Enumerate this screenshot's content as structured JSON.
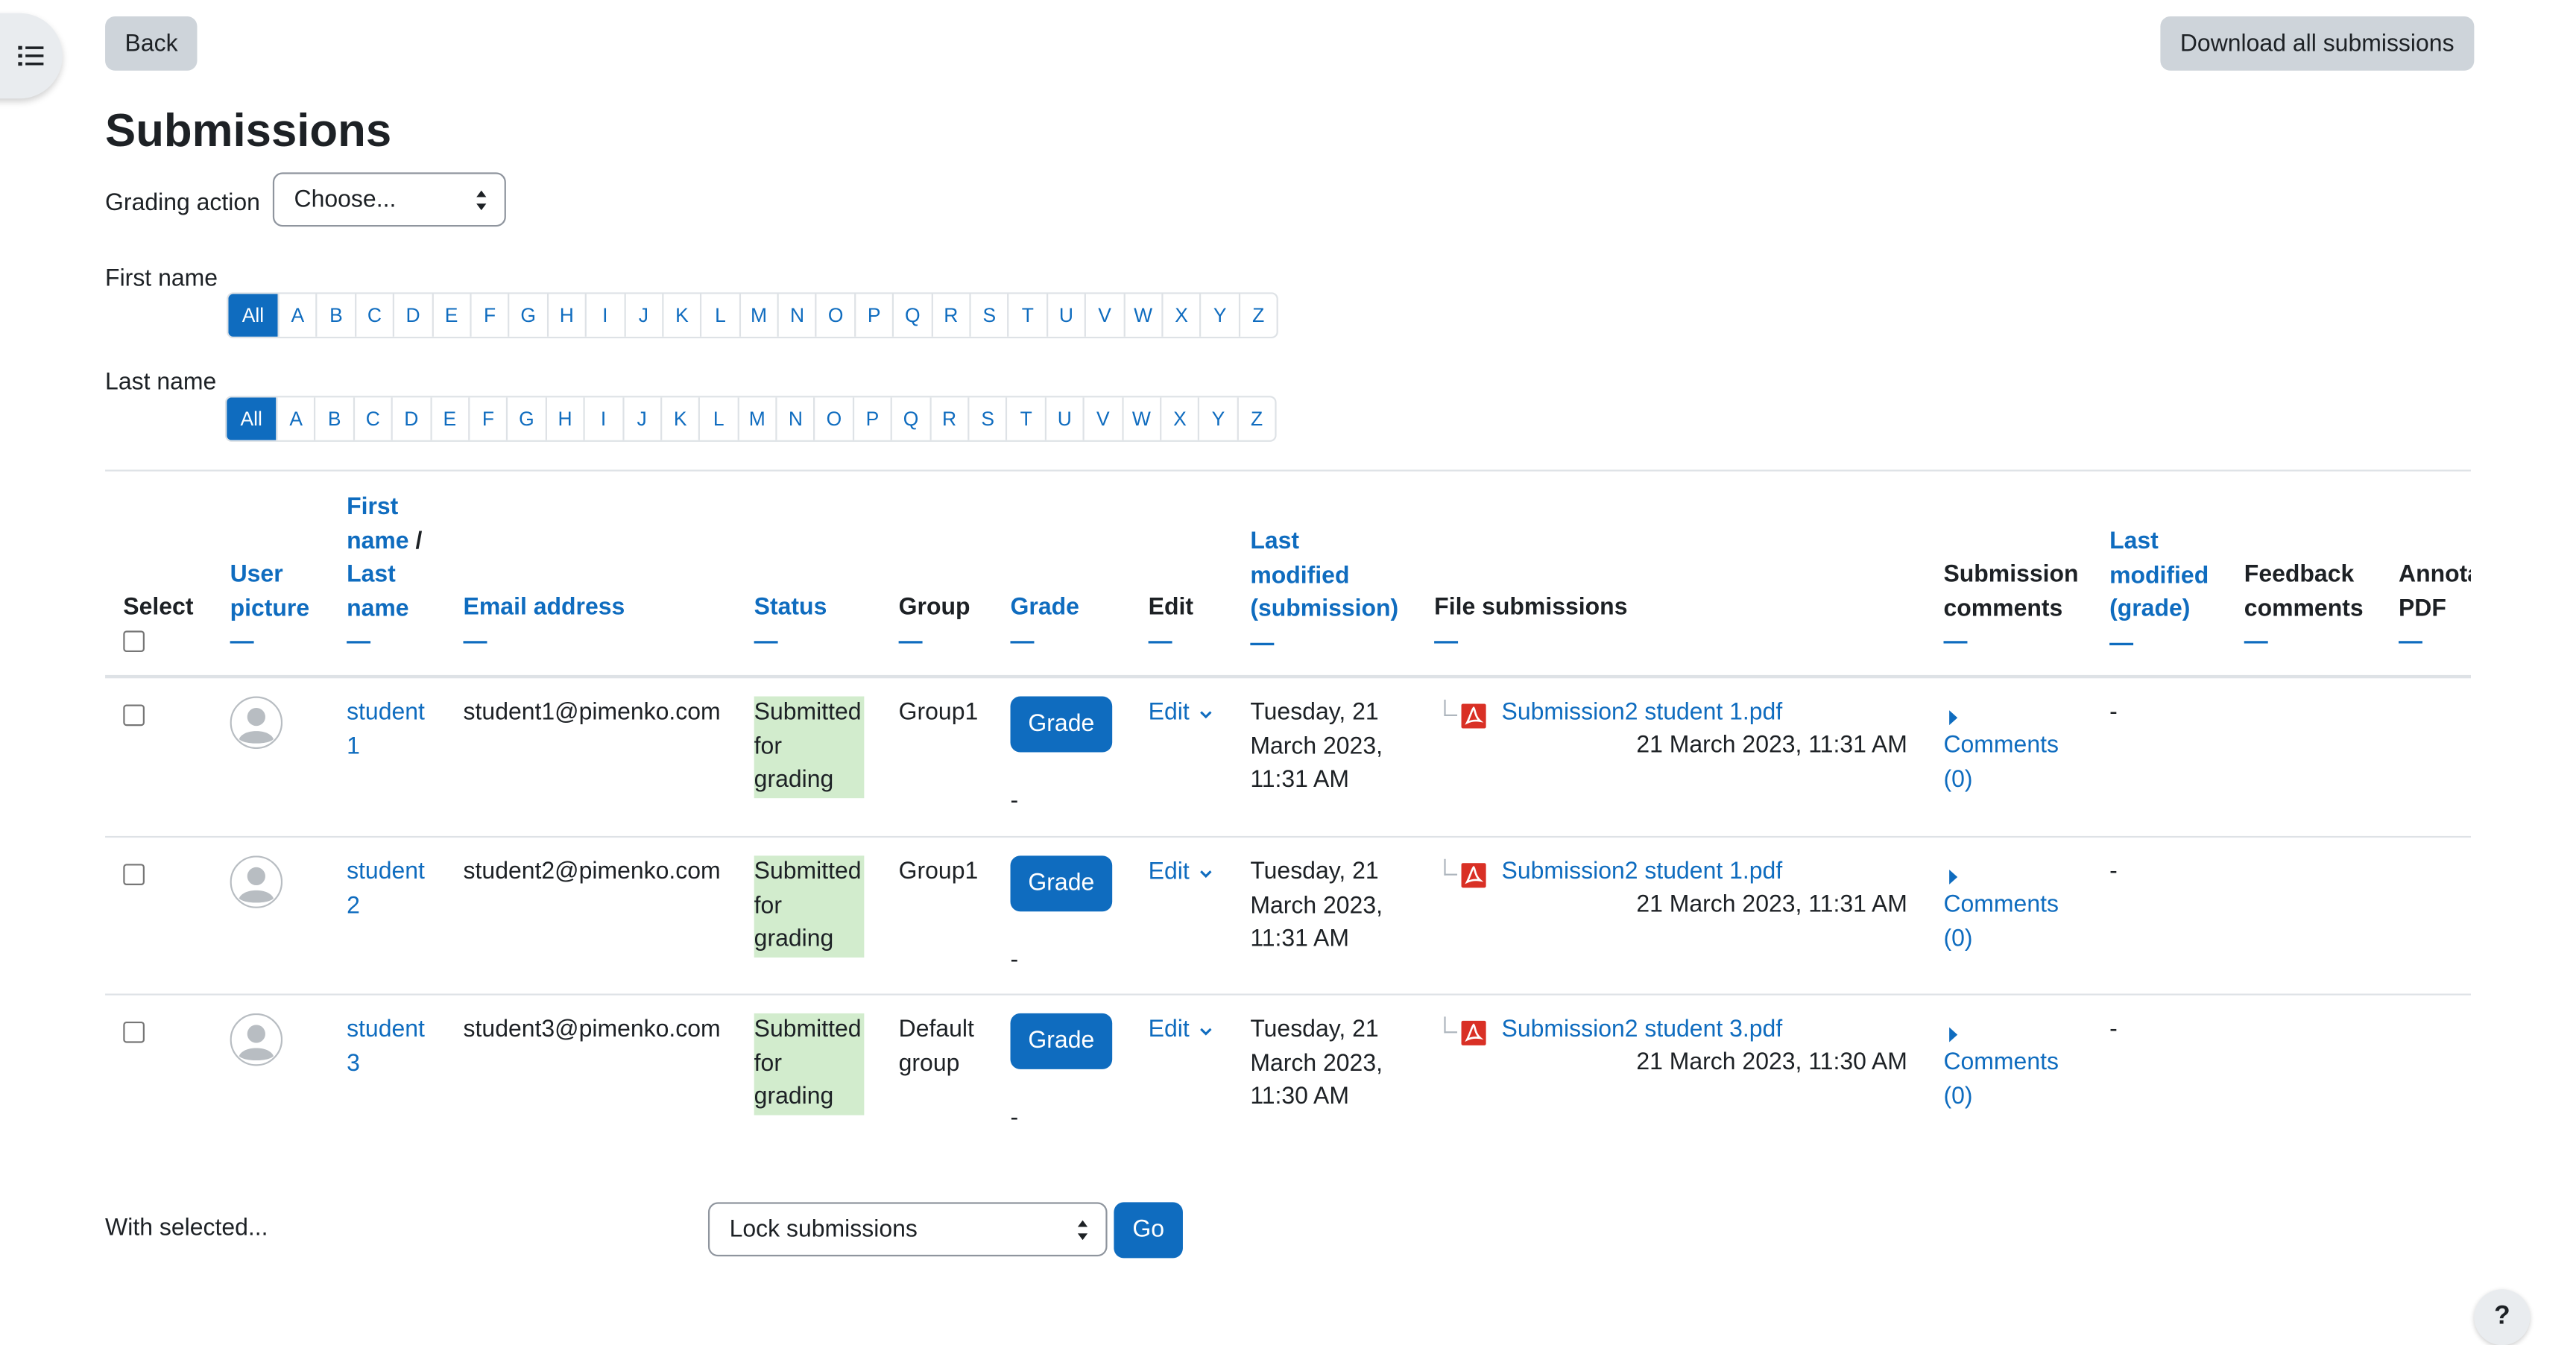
{
  "nav": {
    "back_label": "Back",
    "download_label": "Download all submissions"
  },
  "page": {
    "title": "Submissions"
  },
  "grading_action": {
    "label": "Grading action",
    "selected": "Choose..."
  },
  "initials": {
    "first_label": "First name",
    "last_label": "Last name",
    "all_label": "All",
    "letters": [
      "A",
      "B",
      "C",
      "D",
      "E",
      "F",
      "G",
      "H",
      "I",
      "J",
      "K",
      "L",
      "M",
      "N",
      "O",
      "P",
      "Q",
      "R",
      "S",
      "T",
      "U",
      "V",
      "W",
      "X",
      "Y",
      "Z"
    ]
  },
  "table": {
    "headers": {
      "select": "Select",
      "user_picture_1": "User",
      "user_picture_2": "picture",
      "name_1": "First",
      "name_2": "name",
      "name_sep": "/",
      "name_3": "Last",
      "name_4": "name",
      "email": "Email address",
      "status": "Status",
      "group": "Group",
      "grade": "Grade",
      "edit": "Edit",
      "lastmod_sub_1": "Last",
      "lastmod_sub_2": "modified",
      "lastmod_sub_3": "(submission)",
      "files": "File submissions",
      "sub_comments_1": "Submission",
      "sub_comments_2": "comments",
      "lastmod_grade_1": "Last",
      "lastmod_grade_2": "modified",
      "lastmod_grade_3": "(grade)",
      "feedback_1": "Feedback",
      "feedback_2": "comments",
      "annot_1": "Annotate",
      "annot_2": "PDF",
      "collapse_dash": "—"
    },
    "rows": [
      {
        "name_1": "student",
        "name_2": "1",
        "email": "student1@pimenko.com",
        "status_1": "Submitted",
        "status_2": "for",
        "status_3": "grading",
        "group_1": "Group1",
        "group_2": "",
        "grade_button": "Grade",
        "grade_value": "-",
        "edit": "Edit",
        "lastmod_1": "Tuesday, 21",
        "lastmod_2": "March 2023,",
        "lastmod_3": "11:31 AM",
        "file_name": "Submission2 student 1.pdf",
        "file_date": "21 March 2023, 11:31 AM",
        "comments_1": "Comments",
        "comments_2": "(0)",
        "grade_modified": "-"
      },
      {
        "name_1": "student",
        "name_2": "2",
        "email": "student2@pimenko.com",
        "status_1": "Submitted",
        "status_2": "for",
        "status_3": "grading",
        "group_1": "Group1",
        "group_2": "",
        "grade_button": "Grade",
        "grade_value": "-",
        "edit": "Edit",
        "lastmod_1": "Tuesday, 21",
        "lastmod_2": "March 2023,",
        "lastmod_3": "11:31 AM",
        "file_name": "Submission2 student 1.pdf",
        "file_date": "21 March 2023, 11:31 AM",
        "comments_1": "Comments",
        "comments_2": "(0)",
        "grade_modified": "-"
      },
      {
        "name_1": "student",
        "name_2": "3",
        "email": "student3@pimenko.com",
        "status_1": "Submitted",
        "status_2": "for",
        "status_3": "grading",
        "group_1": "Default",
        "group_2": "group",
        "grade_button": "Grade",
        "grade_value": "-",
        "edit": "Edit",
        "lastmod_1": "Tuesday, 21",
        "lastmod_2": "March 2023,",
        "lastmod_3": "11:30 AM",
        "file_name": "Submission2 student 3.pdf",
        "file_date": "21 March 2023, 11:30 AM",
        "comments_1": "Comments",
        "comments_2": "(0)",
        "grade_modified": "-"
      }
    ]
  },
  "bulk": {
    "label": "With selected...",
    "selected": "Lock submissions",
    "go_label": "Go"
  },
  "help": {
    "label": "?"
  },
  "colors": {
    "link": "#0f6cbf",
    "status_bg": "#d2eccd",
    "button_secondary": "#ced4da"
  }
}
